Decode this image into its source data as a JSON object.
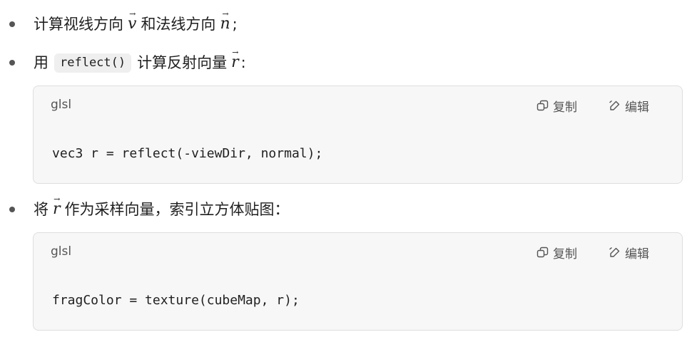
{
  "items": [
    {
      "text_before": "计算视线方向",
      "vec1": "v",
      "text_middle": "和法线方向",
      "vec2": "n",
      "text_after": ";"
    },
    {
      "text_before": "用",
      "code": "reflect()",
      "text_middle": "计算反射向量",
      "vec": "r",
      "text_after": ":"
    },
    {
      "text_before": "将",
      "vec": "r",
      "text_after": "作为采样向量，索引立方体贴图："
    }
  ],
  "code_blocks": [
    {
      "lang": "glsl",
      "copy_label": "复制",
      "edit_label": "编辑",
      "code": "vec3 r = reflect(-viewDir, normal);"
    },
    {
      "lang": "glsl",
      "copy_label": "复制",
      "edit_label": "编辑",
      "code": "fragColor = texture(cubeMap, r);"
    }
  ],
  "icons": {
    "copy": "copy-icon",
    "edit": "edit-icon"
  },
  "colors": {
    "code_bg": "#f7f7f7",
    "inline_code_bg": "#efefef",
    "border": "#dedede"
  }
}
